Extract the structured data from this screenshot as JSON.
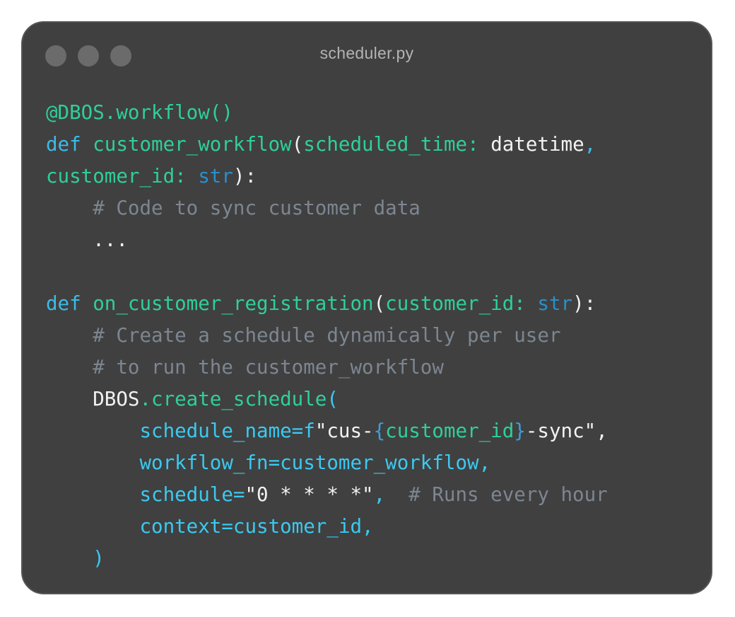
{
  "window": {
    "title": "scheduler.py",
    "traffic_lights": [
      "close",
      "minimize",
      "zoom"
    ]
  },
  "colors": {
    "background": "#404040",
    "decorator": "#2fcf9a",
    "keyword": "#3bbbe8",
    "function": "#2fcf9a",
    "param": "#2fcf9a",
    "type": "#2a8fc9",
    "plain": "#f2f2f2",
    "comment": "#7c8691",
    "kwarg": "#3bc9f0",
    "call": "#2fcf9a",
    "interp": "#3aa0d8"
  },
  "code_lines": [
    [
      {
        "t": "@DBOS.workflow()",
        "c": "decorator"
      }
    ],
    [
      {
        "t": "def ",
        "c": "keyword"
      },
      {
        "t": "customer_workflow",
        "c": "function"
      },
      {
        "t": "(",
        "c": "plain"
      },
      {
        "t": "scheduled_time",
        "c": "param"
      },
      {
        "t": ": ",
        "c": "param"
      },
      {
        "t": "datetime",
        "c": "plain"
      },
      {
        "t": ",",
        "c": "keyword"
      }
    ],
    [
      {
        "t": "customer_id",
        "c": "param"
      },
      {
        "t": ": ",
        "c": "param"
      },
      {
        "t": "str",
        "c": "type"
      },
      {
        "t": "):",
        "c": "plain"
      }
    ],
    [
      {
        "t": "    # Code to sync customer data",
        "c": "comment"
      }
    ],
    [
      {
        "t": "    ...",
        "c": "plain"
      }
    ],
    [],
    [
      {
        "t": "def ",
        "c": "keyword"
      },
      {
        "t": "on_customer_registration",
        "c": "function"
      },
      {
        "t": "(",
        "c": "plain"
      },
      {
        "t": "customer_id",
        "c": "param"
      },
      {
        "t": ": ",
        "c": "param"
      },
      {
        "t": "str",
        "c": "type"
      },
      {
        "t": "):",
        "c": "plain"
      }
    ],
    [
      {
        "t": "    # Create a schedule dynamically per user",
        "c": "comment"
      }
    ],
    [
      {
        "t": "    # to run the customer_workflow",
        "c": "comment"
      }
    ],
    [
      {
        "t": "    DBOS",
        "c": "plain"
      },
      {
        "t": ".create_schedule",
        "c": "call"
      },
      {
        "t": "(",
        "c": "kwarg"
      }
    ],
    [
      {
        "t": "        schedule_name=f",
        "c": "kwarg"
      },
      {
        "t": "\"cus-",
        "c": "plain"
      },
      {
        "t": "{",
        "c": "interp"
      },
      {
        "t": "customer_id",
        "c": "call"
      },
      {
        "t": "}",
        "c": "interp"
      },
      {
        "t": "-sync\",",
        "c": "plain"
      }
    ],
    [
      {
        "t": "        workflow_fn=customer_workflow,",
        "c": "kwarg"
      }
    ],
    [
      {
        "t": "        schedule=",
        "c": "kwarg"
      },
      {
        "t": "\"0 * * * *\"",
        "c": "plain"
      },
      {
        "t": ",  ",
        "c": "kwarg"
      },
      {
        "t": "# Runs every hour",
        "c": "comment"
      }
    ],
    [
      {
        "t": "        context=customer_id,",
        "c": "kwarg"
      }
    ],
    [
      {
        "t": "    )",
        "c": "kwarg"
      }
    ]
  ]
}
